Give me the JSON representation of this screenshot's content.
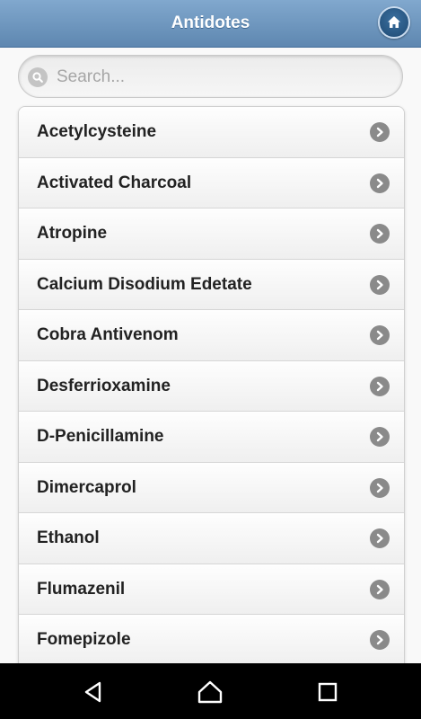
{
  "header": {
    "title": "Antidotes",
    "home_icon": "home-icon"
  },
  "search": {
    "placeholder": "Search...",
    "value": "",
    "icon": "search-icon"
  },
  "items": [
    {
      "label": "Acetylcysteine"
    },
    {
      "label": "Activated Charcoal"
    },
    {
      "label": "Atropine"
    },
    {
      "label": "Calcium Disodium Edetate"
    },
    {
      "label": "Cobra Antivenom"
    },
    {
      "label": "Desferrioxamine"
    },
    {
      "label": "D-Penicillamine"
    },
    {
      "label": "Dimercaprol"
    },
    {
      "label": "Ethanol"
    },
    {
      "label": "Flumazenil"
    },
    {
      "label": "Fomepizole"
    }
  ],
  "navbar": {
    "icons": [
      "back-icon",
      "home-icon",
      "recents-icon"
    ]
  },
  "colors": {
    "header_top": "#81a8ce",
    "header_bottom": "#5e87b0",
    "chevron": "#8a8a8a",
    "navbar": "#000000"
  }
}
